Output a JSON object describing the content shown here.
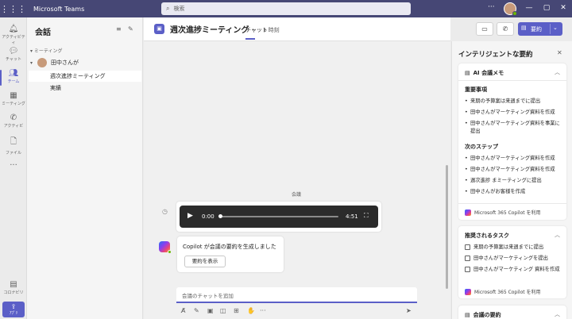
{
  "titlebar": {
    "app_name": "Microsoft Teams",
    "search_placeholder": "検索",
    "more": "···",
    "minimize": "—",
    "maximize": "▢",
    "close": "✕"
  },
  "rail": {
    "items": [
      {
        "label": "アクティビティ",
        "icon": "bell-icon"
      },
      {
        "label": "チャット",
        "icon": "chat-icon"
      },
      {
        "label": "チーム",
        "icon": "teams-icon"
      },
      {
        "label": "ミーティング",
        "icon": "calendar-icon"
      },
      {
        "label": "アクティビ",
        "icon": "phone-icon"
      },
      {
        "label": "ファイル",
        "icon": "file-icon"
      }
    ],
    "more": "···",
    "apps_label": "コロナビリ",
    "store_label": "ｱﾌﾟﾘ"
  },
  "chatlist": {
    "header": "会話",
    "section_meeting": "▾ ミーティング",
    "person_name": "田中さんが",
    "items": [
      "週次進捗ミーティング",
      "実績"
    ]
  },
  "main": {
    "title": "週次進捗ミーティング",
    "tabs": [
      "チャット",
      "1 時刻"
    ],
    "meeting_label": "会議",
    "audio": {
      "current_time": "0:00",
      "duration": "4:51",
      "progress": 0
    },
    "copilot_message": "Copilot が会議の要約を生成しました",
    "show_summary_button": "要約を表示",
    "composer_placeholder": "会議のチャットを追加",
    "summary_button": "要約"
  },
  "rpane": {
    "title": "インテリジェントな要約",
    "close": "✕",
    "ai_notes": {
      "title": "AI 会議メモ",
      "key_points_header": "重要事項",
      "key_points": [
        "来期の予算案は来週までに提出",
        "田中さんがマーケティング資料を作成",
        "田中さんがマーケティング資料を事業に提出"
      ],
      "next_steps_header": "次のステップ",
      "next_steps": [
        "田中さんがマーケティング資料を作成",
        "田中さんがマーケティング資料を作成",
        "週次進捗 まミーティングに提出",
        "田中さんがお客様を作成"
      ],
      "footer": "Microsoft 365 Copilot を利用"
    },
    "tasks": {
      "title": "推奨されるタスク",
      "items": [
        "来期の予算案は来週までに提出",
        "田中さんがマーケティングを提出",
        "田中さんがマーケティング 資料を作成"
      ],
      "footer": "Microsoft 365 Copilot を利用"
    },
    "summary_card_title": "会議の要約"
  }
}
